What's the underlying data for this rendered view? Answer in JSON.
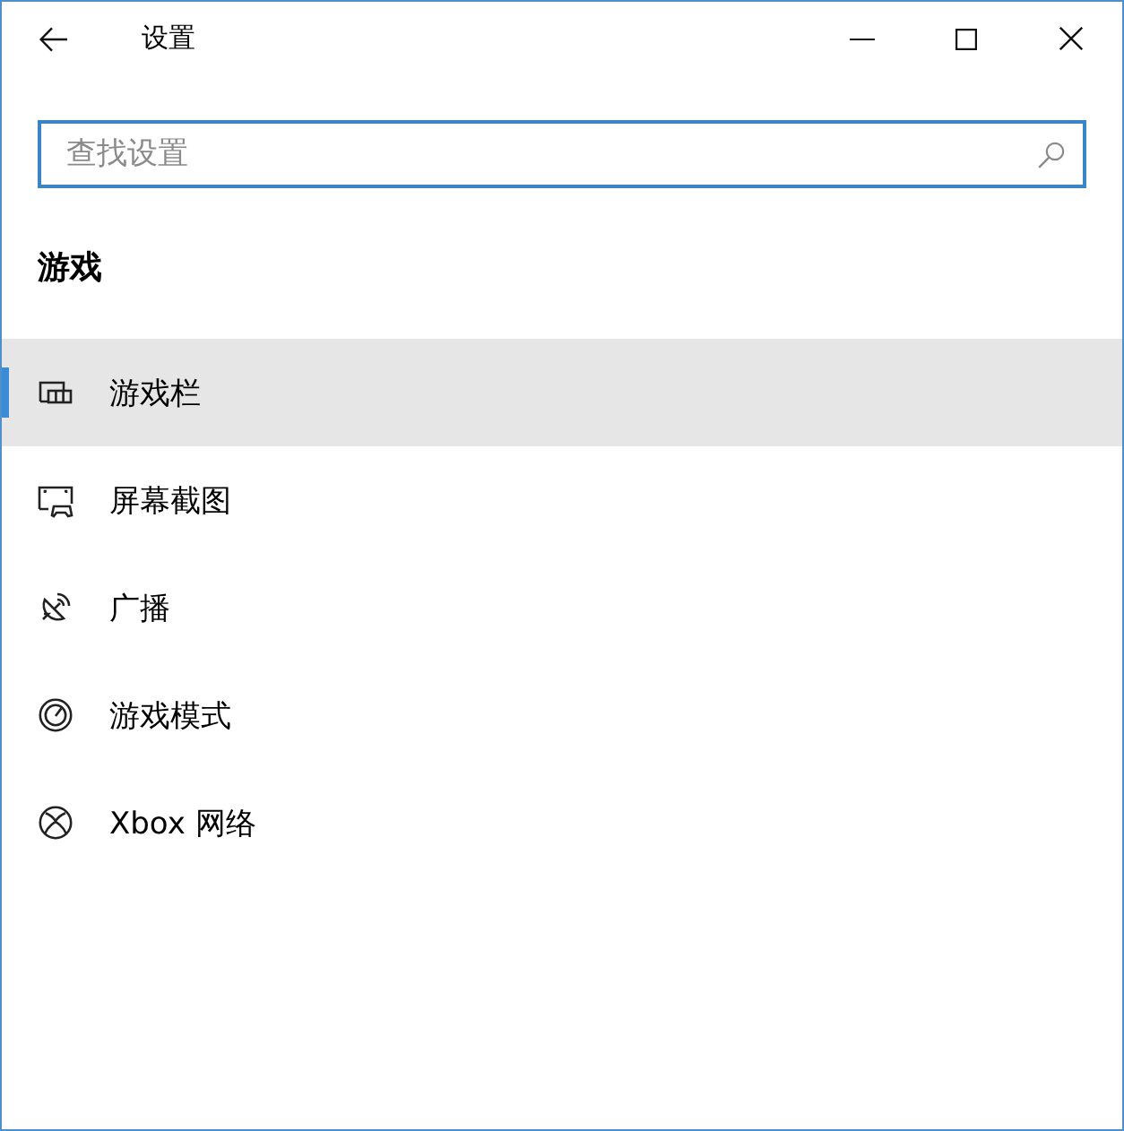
{
  "window": {
    "title": "设置"
  },
  "search": {
    "placeholder": "查找设置"
  },
  "section": {
    "title": "游戏"
  },
  "nav_items": [
    {
      "label": "游戏栏",
      "selected": true
    },
    {
      "label": "屏幕截图",
      "selected": false
    },
    {
      "label": "广播",
      "selected": false
    },
    {
      "label": "游戏模式",
      "selected": false
    },
    {
      "label": "Xbox 网络",
      "selected": false
    }
  ]
}
